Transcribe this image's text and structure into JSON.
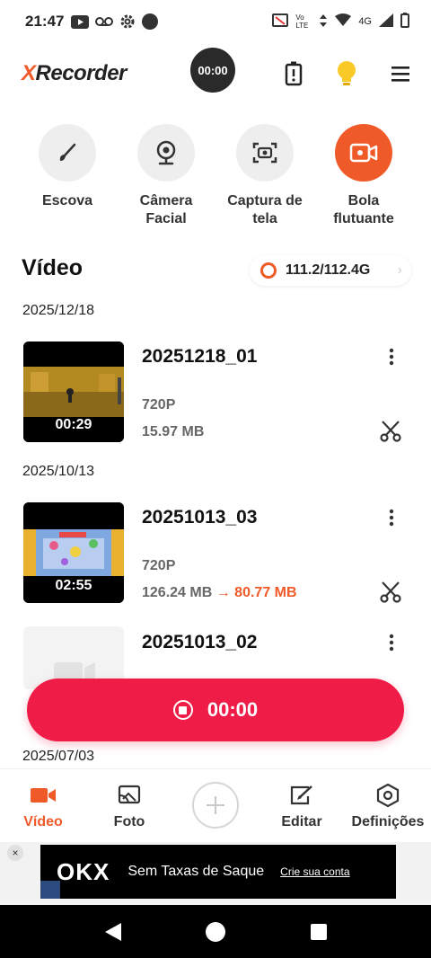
{
  "status_bar": {
    "time": "21:47",
    "network_label": "4G",
    "volte_label": "Vo LTE"
  },
  "header": {
    "brand_x": "X",
    "brand_rest": "Recorder",
    "timer": "00:00"
  },
  "tools": [
    {
      "label": "Escova",
      "icon": "brush-icon"
    },
    {
      "label": "Câmera Facial",
      "icon": "webcam-icon"
    },
    {
      "label": "Captura de tela",
      "icon": "screenshot-icon"
    },
    {
      "label": "Bola flutuante",
      "icon": "floating-ball-icon"
    }
  ],
  "section": {
    "title": "Vídeo",
    "storage": "111.2/112.4G"
  },
  "videos": [
    {
      "date": "2025/12/18",
      "title": "20251218_01",
      "resolution": "720P",
      "size": "15.97 MB",
      "duration": "00:29"
    },
    {
      "date": "2025/10/13",
      "title": "20251013_03",
      "resolution": "720P",
      "size": "126.24 MB",
      "arrow": "→",
      "compressed_size": "80.77 MB",
      "duration": "02:55"
    },
    {
      "title": "20251013_02"
    }
  ],
  "next_date": "2025/07/03",
  "record_button": {
    "label": "00:00"
  },
  "bottom_nav": [
    {
      "label": "Vídeo",
      "icon": "video-icon",
      "active": true
    },
    {
      "label": "Foto",
      "icon": "photo-icon",
      "active": false
    },
    {
      "label": "Editar",
      "icon": "edit-icon",
      "active": false
    },
    {
      "label": "Definições",
      "icon": "settings-icon",
      "active": false
    }
  ],
  "ad": {
    "logo": "OKX",
    "text": "Sem Taxas de Saque",
    "cta": "Crie sua conta",
    "close": "×"
  },
  "colors": {
    "accent": "#f05a28",
    "record": "#ee1c47"
  }
}
